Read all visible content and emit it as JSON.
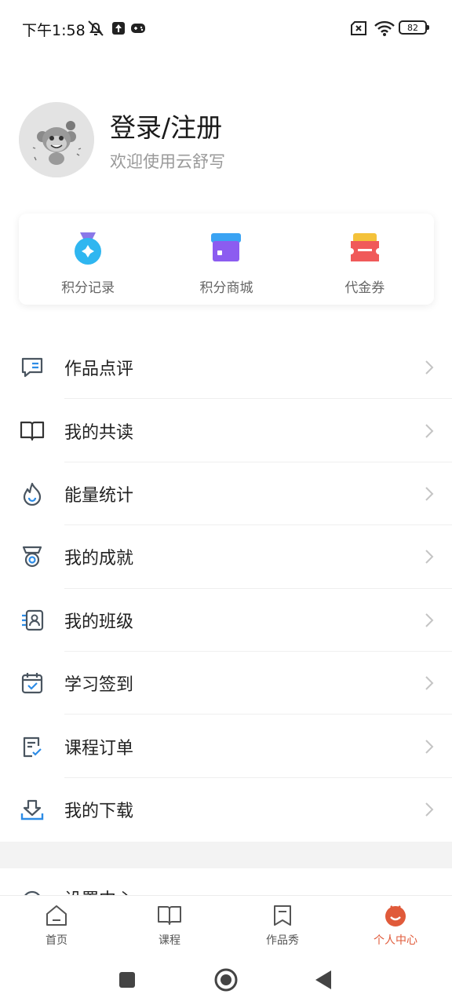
{
  "status_bar": {
    "time": "下午1:58",
    "battery": "82"
  },
  "profile": {
    "title": "登录/注册",
    "subtitle": "欢迎使用云舒写"
  },
  "points": [
    {
      "label": "积分记录",
      "icon": "medal-icon"
    },
    {
      "label": "积分商城",
      "icon": "store-icon"
    },
    {
      "label": "代金券",
      "icon": "coupon-icon"
    }
  ],
  "menu": [
    {
      "label": "作品点评",
      "icon": "comment-icon"
    },
    {
      "label": "我的共读",
      "icon": "book-icon"
    },
    {
      "label": "能量统计",
      "icon": "flame-icon"
    },
    {
      "label": "我的成就",
      "icon": "award-icon"
    },
    {
      "label": "我的班级",
      "icon": "class-icon"
    },
    {
      "label": "学习签到",
      "icon": "calendar-check-icon"
    },
    {
      "label": "课程订单",
      "icon": "order-icon"
    },
    {
      "label": "我的下载",
      "icon": "download-icon"
    }
  ],
  "settings_peek": {
    "label": "设置中心"
  },
  "tabs": [
    {
      "label": "首页",
      "icon": "home-icon"
    },
    {
      "label": "课程",
      "icon": "course-icon"
    },
    {
      "label": "作品秀",
      "icon": "works-icon"
    },
    {
      "label": "个人中心",
      "icon": "profile-icon",
      "active": true
    }
  ],
  "colors": {
    "accent": "#e05a3a",
    "icon_gray": "#4a5560",
    "icon_blue": "#2d8ce6"
  }
}
